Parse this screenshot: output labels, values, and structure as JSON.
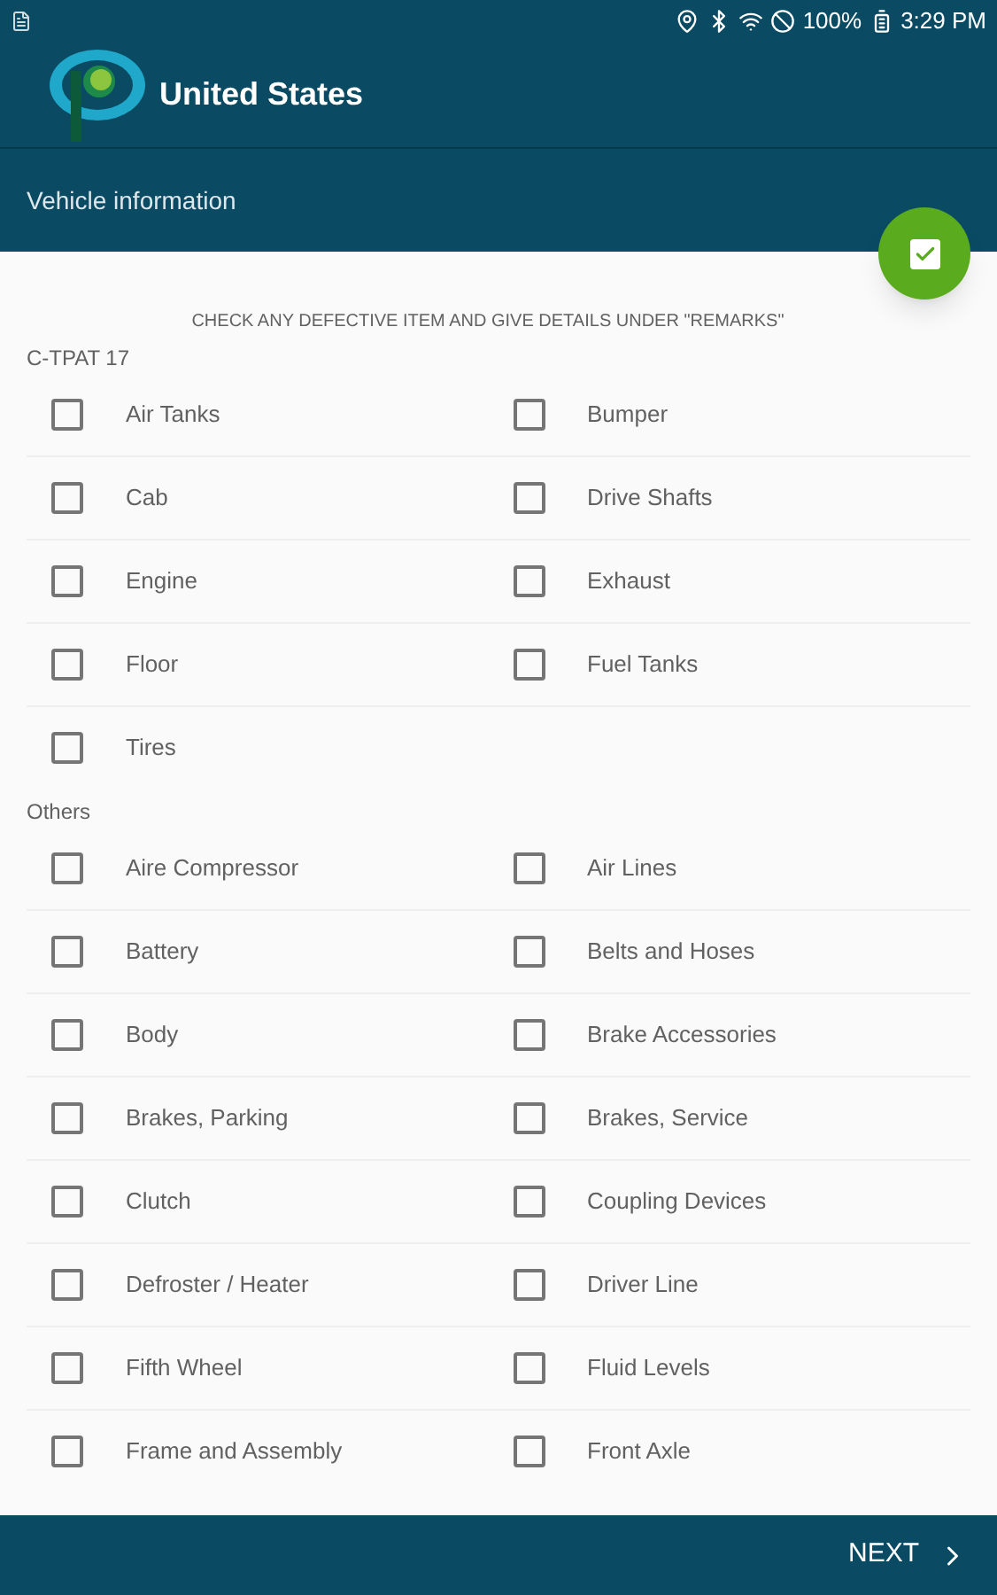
{
  "status_bar": {
    "battery": "100%",
    "time": "3:29 PM"
  },
  "app_bar": {
    "title": "United States"
  },
  "subheader": {
    "title": "Vehicle information"
  },
  "instruction": "CHECK ANY DEFECTIVE ITEM AND GIVE DETAILS UNDER \"REMARKS\"",
  "sections": [
    {
      "title": "C-TPAT 17",
      "items": [
        {
          "label": "Air Tanks",
          "checked": false
        },
        {
          "label": "Bumper",
          "checked": false
        },
        {
          "label": "Cab",
          "checked": false
        },
        {
          "label": "Drive Shafts",
          "checked": false
        },
        {
          "label": "Engine",
          "checked": false
        },
        {
          "label": "Exhaust",
          "checked": false
        },
        {
          "label": "Floor",
          "checked": false
        },
        {
          "label": "Fuel Tanks",
          "checked": false
        },
        {
          "label": "Tires",
          "checked": false
        }
      ]
    },
    {
      "title": "Others",
      "items": [
        {
          "label": "Aire Compressor",
          "checked": false
        },
        {
          "label": "Air Lines",
          "checked": false
        },
        {
          "label": "Battery",
          "checked": false
        },
        {
          "label": "Belts and Hoses",
          "checked": false
        },
        {
          "label": "Body",
          "checked": false
        },
        {
          "label": "Brake Accessories",
          "checked": false
        },
        {
          "label": "Brakes, Parking",
          "checked": false
        },
        {
          "label": "Brakes, Service",
          "checked": false
        },
        {
          "label": "Clutch",
          "checked": false
        },
        {
          "label": "Coupling Devices",
          "checked": false
        },
        {
          "label": "Defroster / Heater",
          "checked": false
        },
        {
          "label": "Driver Line",
          "checked": false
        },
        {
          "label": "Fifth Wheel",
          "checked": false
        },
        {
          "label": "Fluid Levels",
          "checked": false
        },
        {
          "label": "Frame and Assembly",
          "checked": false
        },
        {
          "label": "Front Axle",
          "checked": false
        }
      ]
    }
  ],
  "bottom_bar": {
    "next": "NEXT"
  }
}
